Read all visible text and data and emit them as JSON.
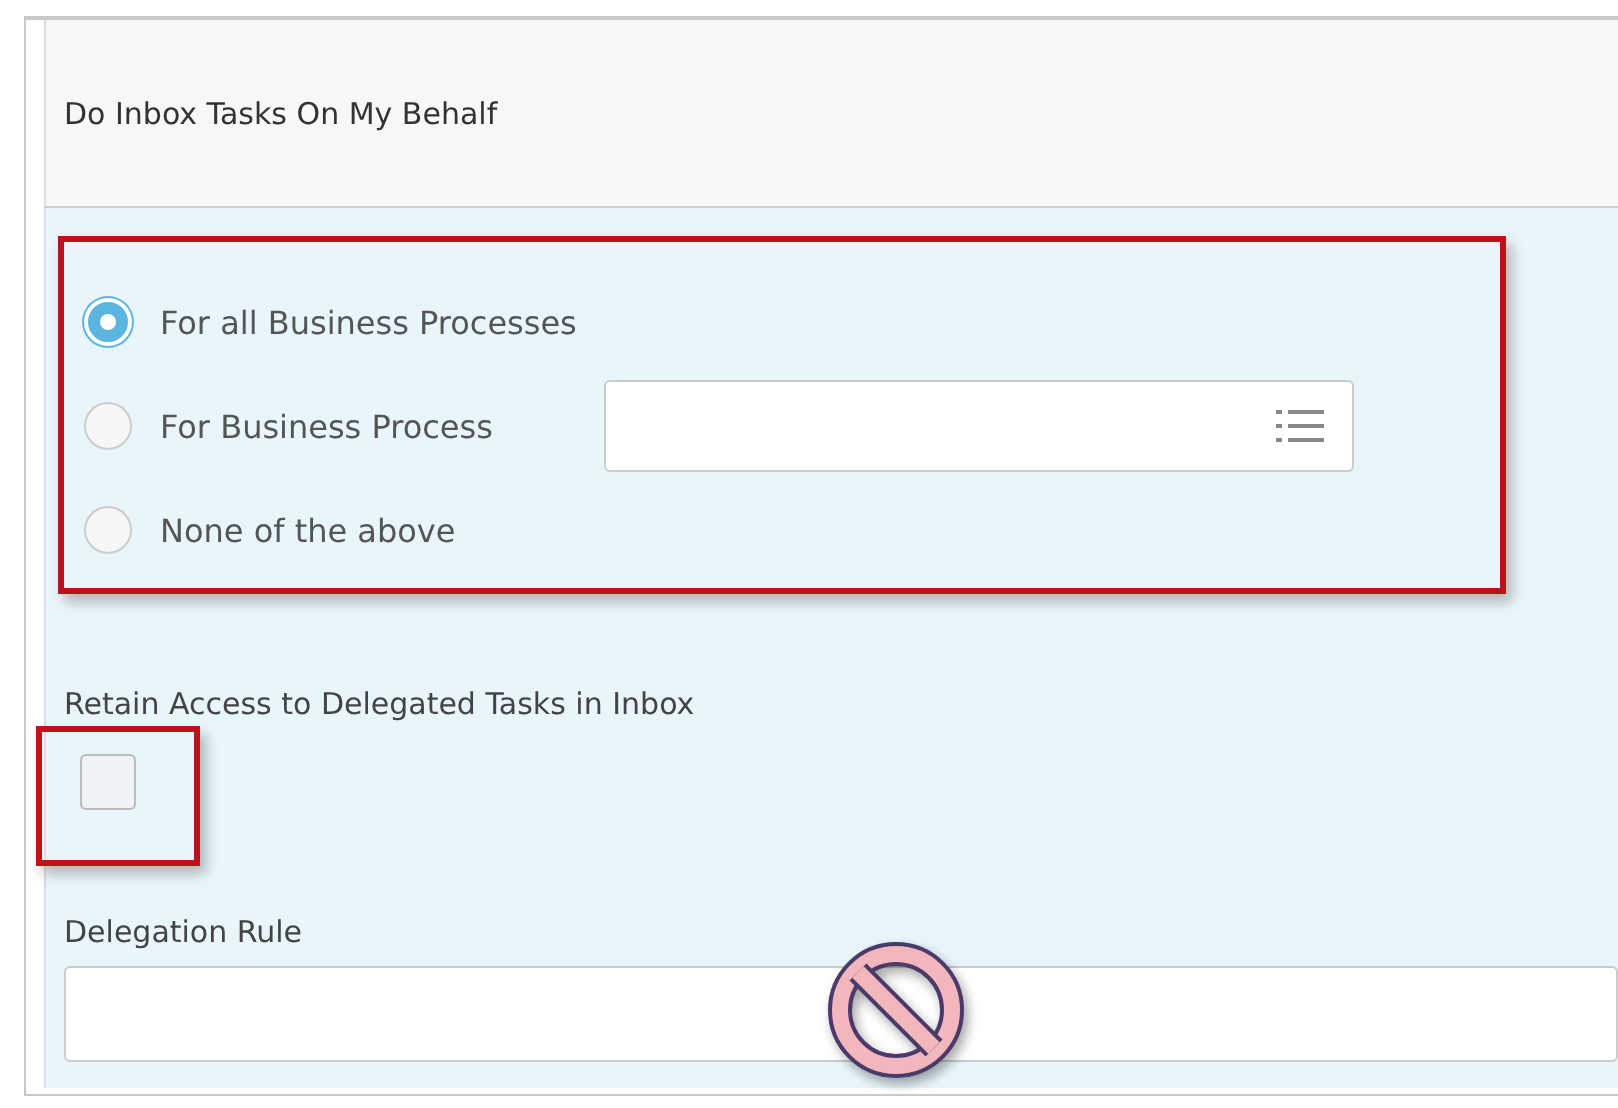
{
  "header": {
    "title": "Do Inbox Tasks On My Behalf"
  },
  "options": [
    {
      "label": "For all Business Processes",
      "selected": true,
      "kind": "plain"
    },
    {
      "label": "For Business Process",
      "selected": false,
      "kind": "select"
    },
    {
      "label": "None of the above",
      "selected": false,
      "kind": "plain"
    }
  ],
  "retain_access": {
    "label": "Retain Access to Delegated Tasks in Inbox",
    "checked": false
  },
  "delegation_rule": {
    "label": "Delegation Rule"
  }
}
